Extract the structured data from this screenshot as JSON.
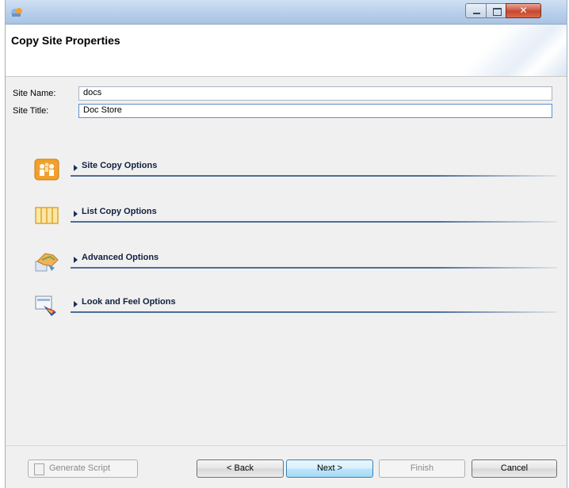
{
  "window": {
    "title": ""
  },
  "header": {
    "title": "Copy Site Properties"
  },
  "fields": {
    "site_name": {
      "label": "Site Name:",
      "value": "docs"
    },
    "site_title": {
      "label": "Site Title:",
      "value": "Doc Store"
    }
  },
  "sections": [
    {
      "label": "Site Copy Options",
      "icon": "people-icon"
    },
    {
      "label": "List Copy Options",
      "icon": "list-columns-icon"
    },
    {
      "label": "Advanced Options",
      "icon": "handshake-icon"
    },
    {
      "label": "Look and Feel Options",
      "icon": "paint-palette-icon"
    }
  ],
  "buttons": {
    "generate_script": "Generate Script",
    "back": "< Back",
    "next": "Next >",
    "finish": "Finish",
    "cancel": "Cancel"
  },
  "colors": {
    "section_text": "#10203f",
    "section_line": "#4b6d99",
    "primary_button_border": "#3c7fb1"
  }
}
